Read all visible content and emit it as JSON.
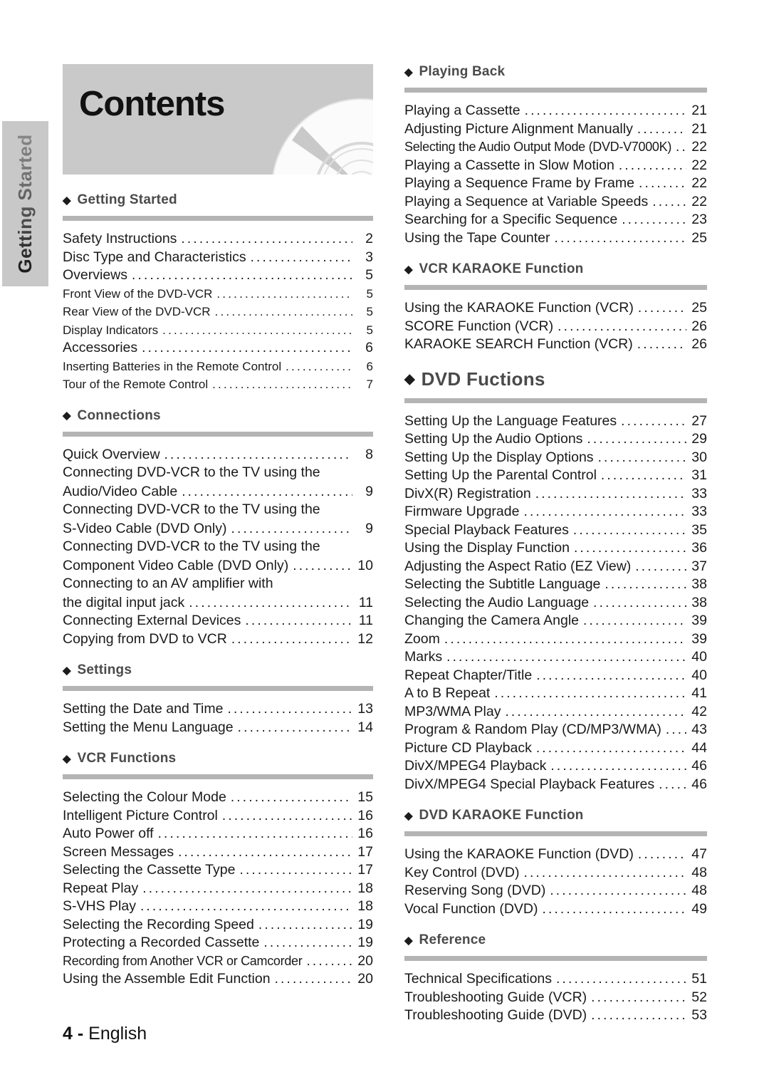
{
  "banner": {
    "title": "Contents",
    "disc_icon": "cd-disc-icon"
  },
  "side_tab": {
    "label": "Getting Started"
  },
  "footer": {
    "page_number": "4 -",
    "language": "English"
  },
  "colors": {
    "banner_bg": "#c9c9c9",
    "rule": "#b4b4b4",
    "heading_text": "#4a4a4a",
    "body_text": "#1a1a1a"
  },
  "left_column": [
    {
      "heading": "Getting Started",
      "heading_size": "normal",
      "entries": [
        {
          "label": "Safety Instructions",
          "page": "2",
          "level": "main"
        },
        {
          "label": "Disc Type and Characteristics",
          "page": "3",
          "level": "main"
        },
        {
          "label": "Overviews",
          "page": "5",
          "level": "main"
        },
        {
          "label": "Front View of the DVD-VCR",
          "page": "5",
          "level": "sub"
        },
        {
          "label": "Rear View of the DVD-VCR",
          "page": "5",
          "level": "sub"
        },
        {
          "label": "Display Indicators",
          "page": "5",
          "level": "sub"
        },
        {
          "label": "Accessories",
          "page": "6",
          "level": "main"
        },
        {
          "label": "Inserting Batteries in the Remote Control",
          "page": "6",
          "level": "sub"
        },
        {
          "label": "Tour of the Remote Control",
          "page": "7",
          "level": "sub"
        }
      ]
    },
    {
      "heading": "Connections",
      "heading_size": "normal",
      "entries": [
        {
          "label": "Quick Overview",
          "page": "8",
          "level": "main"
        },
        {
          "label": "Connecting DVD-VCR to the TV using the",
          "page": "",
          "level": "cont"
        },
        {
          "label": "Audio/Video Cable",
          "page": "9",
          "level": "main"
        },
        {
          "label": "Connecting DVD-VCR to the TV using the",
          "page": "",
          "level": "cont"
        },
        {
          "label": "S-Video Cable (DVD Only)",
          "page": "9",
          "level": "main"
        },
        {
          "label": "Connecting DVD-VCR to the TV using the",
          "page": "",
          "level": "cont"
        },
        {
          "label": "Component Video Cable (DVD Only)",
          "page": "10",
          "level": "main"
        },
        {
          "label": "Connecting to an AV amplifier with",
          "page": "",
          "level": "cont"
        },
        {
          "label": "the digital input jack",
          "page": "11",
          "level": "main"
        },
        {
          "label": "Connecting External Devices",
          "page": "11",
          "level": "main"
        },
        {
          "label": "Copying from DVD to VCR",
          "page": "12",
          "level": "main"
        }
      ]
    },
    {
      "heading": "Settings",
      "heading_size": "normal",
      "entries": [
        {
          "label": "Setting the Date and Time",
          "page": "13",
          "level": "main"
        },
        {
          "label": "Setting the Menu Language",
          "page": "14",
          "level": "main"
        }
      ]
    },
    {
      "heading": "VCR Functions",
      "heading_size": "normal",
      "entries": [
        {
          "label": "Selecting the Colour Mode",
          "page": "15",
          "level": "main"
        },
        {
          "label": "Intelligent Picture Control",
          "page": "16",
          "level": "main"
        },
        {
          "label": "Auto Power off",
          "page": "16",
          "level": "main"
        },
        {
          "label": "Screen Messages",
          "page": "17",
          "level": "main"
        },
        {
          "label": "Selecting the Cassette Type",
          "page": "17",
          "level": "main"
        },
        {
          "label": "Repeat Play",
          "page": "18",
          "level": "main"
        },
        {
          "label": "S-VHS Play",
          "page": "18",
          "level": "main"
        },
        {
          "label": "Selecting the Recording Speed",
          "page": "19",
          "level": "main"
        },
        {
          "label": "Protecting a Recorded Cassette",
          "page": "19",
          "level": "main"
        },
        {
          "label": "Recording from Another VCR or Camcorder",
          "page": "20",
          "level": "narrow"
        },
        {
          "label": "Using the Assemble Edit Function",
          "page": "20",
          "level": "main"
        }
      ]
    }
  ],
  "right_column": [
    {
      "heading": "Playing Back",
      "heading_size": "normal",
      "entries": [
        {
          "label": "Playing a Cassette",
          "page": "21",
          "level": "main"
        },
        {
          "label": "Adjusting Picture Alignment Manually",
          "page": "21",
          "level": "main"
        },
        {
          "label": "Selecting the Audio Output Mode (DVD-V7000K)",
          "page": "22",
          "level": "narrow"
        },
        {
          "label": "Playing a Cassette in Slow Motion",
          "page": "22",
          "level": "main"
        },
        {
          "label": "Playing a Sequence Frame by Frame",
          "page": "22",
          "level": "main"
        },
        {
          "label": "Playing a Sequence at Variable Speeds",
          "page": "22",
          "level": "main"
        },
        {
          "label": "Searching for a Specific Sequence",
          "page": "23",
          "level": "main"
        },
        {
          "label": "Using the Tape Counter",
          "page": "25",
          "level": "main"
        }
      ]
    },
    {
      "heading": "VCR KARAOKE Function",
      "heading_size": "normal",
      "entries": [
        {
          "label": "Using the KARAOKE Function (VCR)",
          "page": "25",
          "level": "main"
        },
        {
          "label": "SCORE Function (VCR)",
          "page": "26",
          "level": "main"
        },
        {
          "label": "KARAOKE SEARCH Function (VCR)",
          "page": "26",
          "level": "main"
        }
      ]
    },
    {
      "heading": "DVD Fuctions",
      "heading_size": "big",
      "entries": [
        {
          "label": "Setting Up the Language Features",
          "page": "27",
          "level": "main"
        },
        {
          "label": "Setting Up the Audio Options",
          "page": "29",
          "level": "main"
        },
        {
          "label": "Setting Up the Display Options",
          "page": "30",
          "level": "main"
        },
        {
          "label": "Setting Up the Parental Control",
          "page": "31",
          "level": "main"
        },
        {
          "label": "DivX(R) Registration",
          "page": "33",
          "level": "main"
        },
        {
          "label": "Firmware Upgrade",
          "page": "33",
          "level": "main"
        },
        {
          "label": "Special Playback Features",
          "page": "35",
          "level": "main"
        },
        {
          "label": "Using the Display Function",
          "page": "36",
          "level": "main"
        },
        {
          "label": "Adjusting the Aspect Ratio (EZ View)",
          "page": "37",
          "level": "main"
        },
        {
          "label": "Selecting the Subtitle Language",
          "page": "38",
          "level": "main"
        },
        {
          "label": "Selecting the Audio Language",
          "page": "38",
          "level": "main"
        },
        {
          "label": "Changing the Camera Angle",
          "page": "39",
          "level": "main"
        },
        {
          "label": "Zoom",
          "page": "39",
          "level": "main"
        },
        {
          "label": "Marks",
          "page": "40",
          "level": "main"
        },
        {
          "label": "Repeat Chapter/Title",
          "page": "40",
          "level": "main"
        },
        {
          "label": "A to B Repeat",
          "page": "41",
          "level": "main"
        },
        {
          "label": "MP3/WMA Play",
          "page": "42",
          "level": "main"
        },
        {
          "label": "Program & Random Play (CD/MP3/WMA)",
          "page": "43",
          "level": "main"
        },
        {
          "label": "Picture CD Playback",
          "page": "44",
          "level": "main"
        },
        {
          "label": "DivX/MPEG4 Playback",
          "page": "46",
          "level": "main"
        },
        {
          "label": "DivX/MPEG4 Special Playback Features",
          "page": "46",
          "level": "main"
        }
      ]
    },
    {
      "heading": "DVD KARAOKE Function",
      "heading_size": "normal",
      "entries": [
        {
          "label": "Using the KARAOKE Function (DVD)",
          "page": "47",
          "level": "main"
        },
        {
          "label": "Key Control (DVD)",
          "page": "48",
          "level": "main"
        },
        {
          "label": "Reserving Song (DVD)",
          "page": "48",
          "level": "main"
        },
        {
          "label": "Vocal Function (DVD)",
          "page": "49",
          "level": "main"
        }
      ]
    },
    {
      "heading": "Reference",
      "heading_size": "normal",
      "entries": [
        {
          "label": "Technical Specifications",
          "page": "51",
          "level": "main"
        },
        {
          "label": "Troubleshooting Guide (VCR)",
          "page": "52",
          "level": "main"
        },
        {
          "label": "Troubleshooting Guide (DVD)",
          "page": "53",
          "level": "main"
        }
      ]
    }
  ]
}
